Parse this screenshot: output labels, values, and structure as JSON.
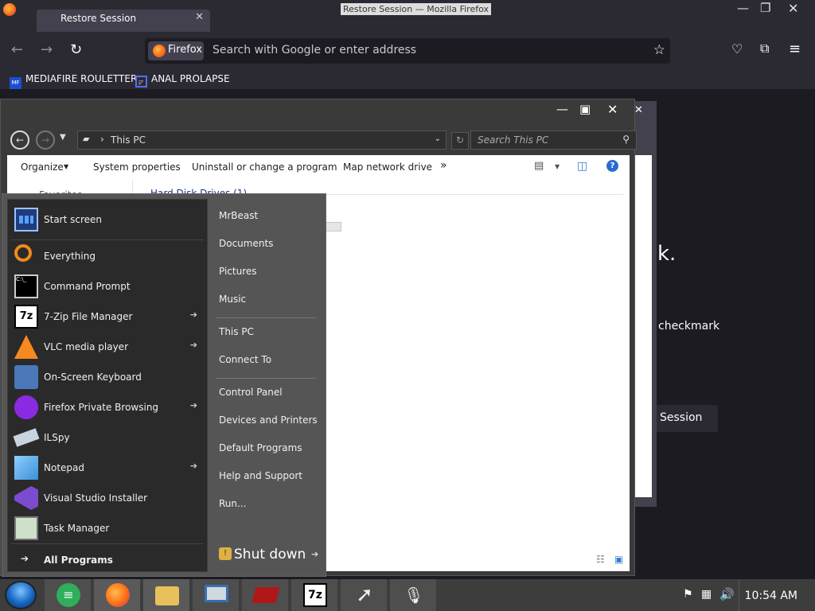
{
  "firefox": {
    "tab_title": "Restore Session",
    "window_title": "Restore Session — Mozilla Firefox",
    "identity_label": "Firefox",
    "url_placeholder": "Search with Google or enter address",
    "bookmarks": [
      {
        "label": "MEDIAFIRE ROULETTER",
        "icon": "mediafire-icon"
      },
      {
        "label": "ANAL PROLAPSE",
        "icon": "bookmark-triangle-icon"
      }
    ],
    "page_fragments": {
      "heading_tail": "k.",
      "body_tail": "checkmark",
      "button_tail": "Session"
    }
  },
  "explorer": {
    "breadcrumb": "This PC",
    "search_placeholder": "Search This PC",
    "commands": [
      "Organize",
      "System properties",
      "Uninstall or change a program",
      "Map network drive"
    ],
    "more": "»",
    "group_header": "Hard Disk Drives (1)",
    "nav_peek": "Favorites"
  },
  "start_menu": {
    "pinned": [
      {
        "label": "Start screen",
        "icon": "start-screen-icon",
        "submenu": false
      }
    ],
    "recent": [
      {
        "label": "Everything",
        "icon": "everything-search-icon",
        "submenu": false
      },
      {
        "label": "Command Prompt",
        "icon": "command-prompt-icon",
        "submenu": false
      },
      {
        "label": "7-Zip File Manager",
        "icon": "7zip-icon",
        "submenu": true
      },
      {
        "label": "VLC media player",
        "icon": "vlc-cone-icon",
        "submenu": true
      },
      {
        "label": "On-Screen Keyboard",
        "icon": "keyboard-icon",
        "submenu": false
      },
      {
        "label": "Firefox Private Browsing",
        "icon": "firefox-private-icon",
        "submenu": true
      },
      {
        "label": "ILSpy",
        "icon": "ilspy-icon",
        "submenu": false
      },
      {
        "label": "Notepad",
        "icon": "notepad-icon",
        "submenu": true
      },
      {
        "label": "Visual Studio Installer",
        "icon": "visual-studio-installer-icon",
        "submenu": false
      },
      {
        "label": "Task Manager",
        "icon": "task-manager-icon",
        "submenu": false
      }
    ],
    "all_programs": "All Programs",
    "right_group1": [
      "MrBeast",
      "Documents",
      "Pictures",
      "Music"
    ],
    "right_group2": [
      "This PC",
      "Connect To"
    ],
    "right_group3": [
      "Control Panel",
      "Devices and Printers",
      "Default Programs",
      "Help and Support",
      "Run..."
    ],
    "shutdown": "Shut down"
  },
  "taskbar": {
    "apps": [
      "start-orb-icon",
      "google-docs-icon",
      "firefox-icon",
      "file-explorer-icon",
      "remote-desktop-icon",
      "graphics-card-icon",
      "7zip-icon",
      "cursor-icon",
      "microphone-icon"
    ],
    "clock": "10:54 AM"
  }
}
